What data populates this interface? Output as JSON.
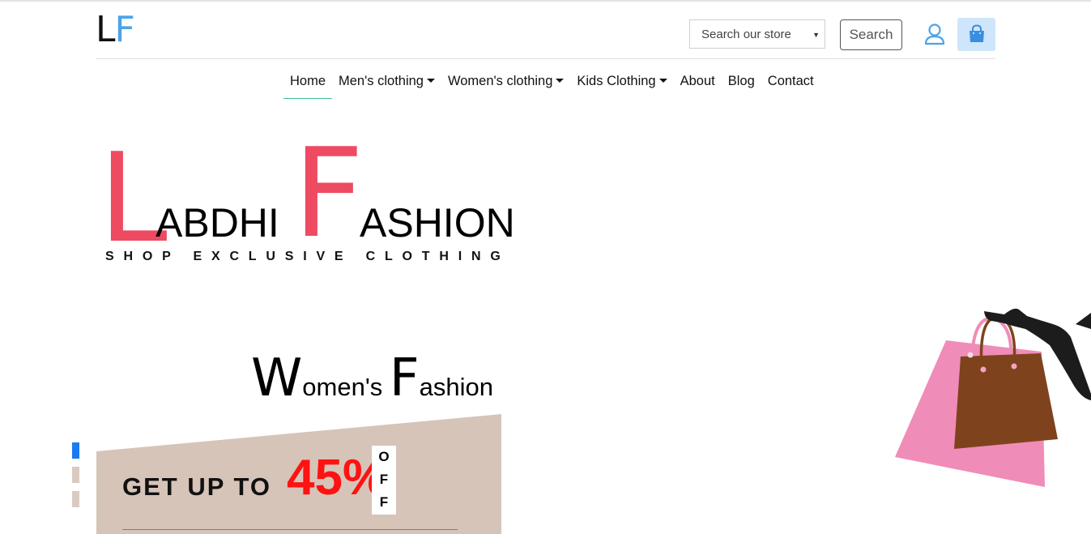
{
  "header": {
    "logo": {
      "first": "L",
      "second": "F"
    },
    "search_select": {
      "selected": "Search our store"
    },
    "search_button": "Search"
  },
  "nav": {
    "items": [
      {
        "label": "Home",
        "active": true,
        "dropdown": false
      },
      {
        "label": "Men's clothing",
        "dropdown": true
      },
      {
        "label": "Women's clothing",
        "dropdown": true
      },
      {
        "label": "Kids Clothing",
        "dropdown": true
      },
      {
        "label": "About",
        "dropdown": false
      },
      {
        "label": "Blog",
        "dropdown": false
      },
      {
        "label": "Contact",
        "dropdown": false
      }
    ]
  },
  "hero": {
    "brand": {
      "first_cap": "L",
      "first_rest": "ABDHI",
      "second_cap": "F",
      "second_rest": "ASHION"
    },
    "tagline": "SHOP EXCLUSIVE CLOTHING",
    "slide_title": {
      "cap1": "W",
      "rest1": "omen's ",
      "cap2": "F",
      "rest2": "ashion"
    },
    "promo": {
      "text": "GET UP TO",
      "percent": "45%",
      "off": [
        "O",
        "F",
        "F"
      ]
    }
  },
  "carousel": {
    "slides": 3,
    "active_index": 0
  },
  "colors": {
    "accent_blue": "#4da3e8",
    "brand_red": "#ee4a62",
    "promo_bg": "#d6c4b8",
    "promo_red": "#ff1212",
    "nav_active": "#3ec08c",
    "indicator_active": "#1a7bf0",
    "indicator_inactive": "#d9cbc1"
  },
  "icons": {
    "user": "user-icon",
    "cart": "shopping-bag-icon",
    "hero_art": "shopping-bag-illustration"
  }
}
